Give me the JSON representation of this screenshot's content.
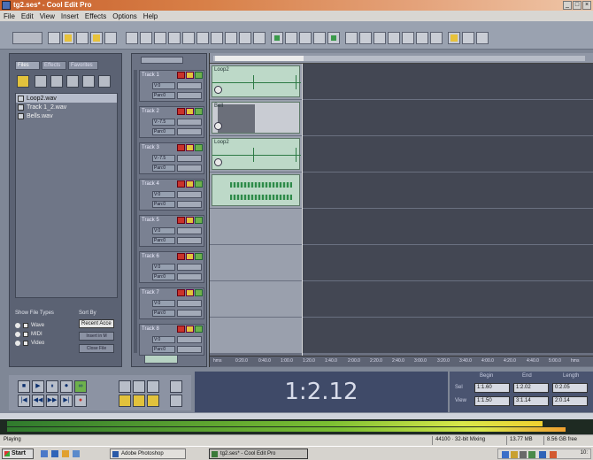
{
  "window": {
    "title": "tg2.ses* - Cool Edit Pro",
    "controls": [
      "_",
      "□",
      "×"
    ]
  },
  "menu": [
    "File",
    "Edit",
    "View",
    "Insert",
    "Effects",
    "Options",
    "Help"
  ],
  "file_panel": {
    "tabs": [
      "Files",
      "Effects",
      "Favorites"
    ],
    "files": [
      "Loop2.wav",
      "Track 1_2.wav",
      "Bells.wav"
    ],
    "show_file_types_label": "Show File Types",
    "sort_by_label": "Sort By",
    "types": [
      "Wave",
      "MIDI",
      "Video"
    ],
    "sort_value": "Recent Acce",
    "buttons": [
      "Insert in M",
      "Close File"
    ]
  },
  "tracks": [
    {
      "name": "Track 1",
      "vol": "V:0",
      "pan": "Pan:0"
    },
    {
      "name": "Track 2",
      "vol": "V:-7.5",
      "pan": "Pan:0"
    },
    {
      "name": "Track 3",
      "vol": "V:-7.5",
      "pan": "Pan:0"
    },
    {
      "name": "Track 4",
      "vol": "V:0",
      "pan": "Pan:0"
    },
    {
      "name": "Track 5",
      "vol": "V:0",
      "pan": "Pan:0"
    },
    {
      "name": "Track 6",
      "vol": "V:0",
      "pan": "Pan:0"
    },
    {
      "name": "Track 7",
      "vol": "V:0",
      "pan": "Pan:0"
    },
    {
      "name": "Track 8",
      "vol": "V:0",
      "pan": "Pan:0"
    }
  ],
  "track_controls": {
    "record": "R",
    "solo": "S",
    "mute": "M"
  },
  "clips": [
    {
      "label": "Loop2"
    },
    {
      "label": "Bell"
    },
    {
      "label": "Loop2"
    },
    {
      "label": ""
    }
  ],
  "ruler_ticks": [
    "hms",
    "0:20.0",
    "0:40.0",
    "1:00.0",
    "1:20.0",
    "1:40.0",
    "2:00.0",
    "2:20.0",
    "2:40.0",
    "3:00.0",
    "3:20.0",
    "3:40.0",
    "4:00.0",
    "4:20.0",
    "4:40.0",
    "5:00.0",
    "hms"
  ],
  "transport": {
    "row1": [
      "■",
      "▶",
      "⏸",
      "⏺",
      "∞"
    ],
    "row2": [
      "|◀",
      "◀◀",
      "▶▶",
      "▶|",
      "●"
    ]
  },
  "time_display": "1:2.12",
  "selection_view": {
    "headers": [
      "Begin",
      "End",
      "Length"
    ],
    "rows": [
      {
        "label": "Sel",
        "begin": "1:1.60",
        "end": "1:2.02",
        "length": "0:2.05"
      },
      {
        "label": "View",
        "begin": "1:1.50",
        "end": "3:1.14",
        "length": "2:0.14"
      }
    ]
  },
  "meter": {
    "level_top": 0.93,
    "level_bottom": 0.97
  },
  "status": {
    "state": "Playing",
    "sample_rate": "44100 · 32-bit Mixing",
    "memory": "13.77 MB",
    "disk_free": "8.56 GB free"
  },
  "taskbar": {
    "start_label": "Start",
    "tasks": [
      "Adobe Photoshop",
      "tg2.ses* - Cool Edit Pro"
    ],
    "clock": "10:"
  },
  "colors": {
    "clip_green": "#bdd9c8",
    "record_red": "#c9332b",
    "solo_yellow": "#e3c43b",
    "mute_green": "#6eb14c",
    "time_bg": "#3f4a68"
  }
}
